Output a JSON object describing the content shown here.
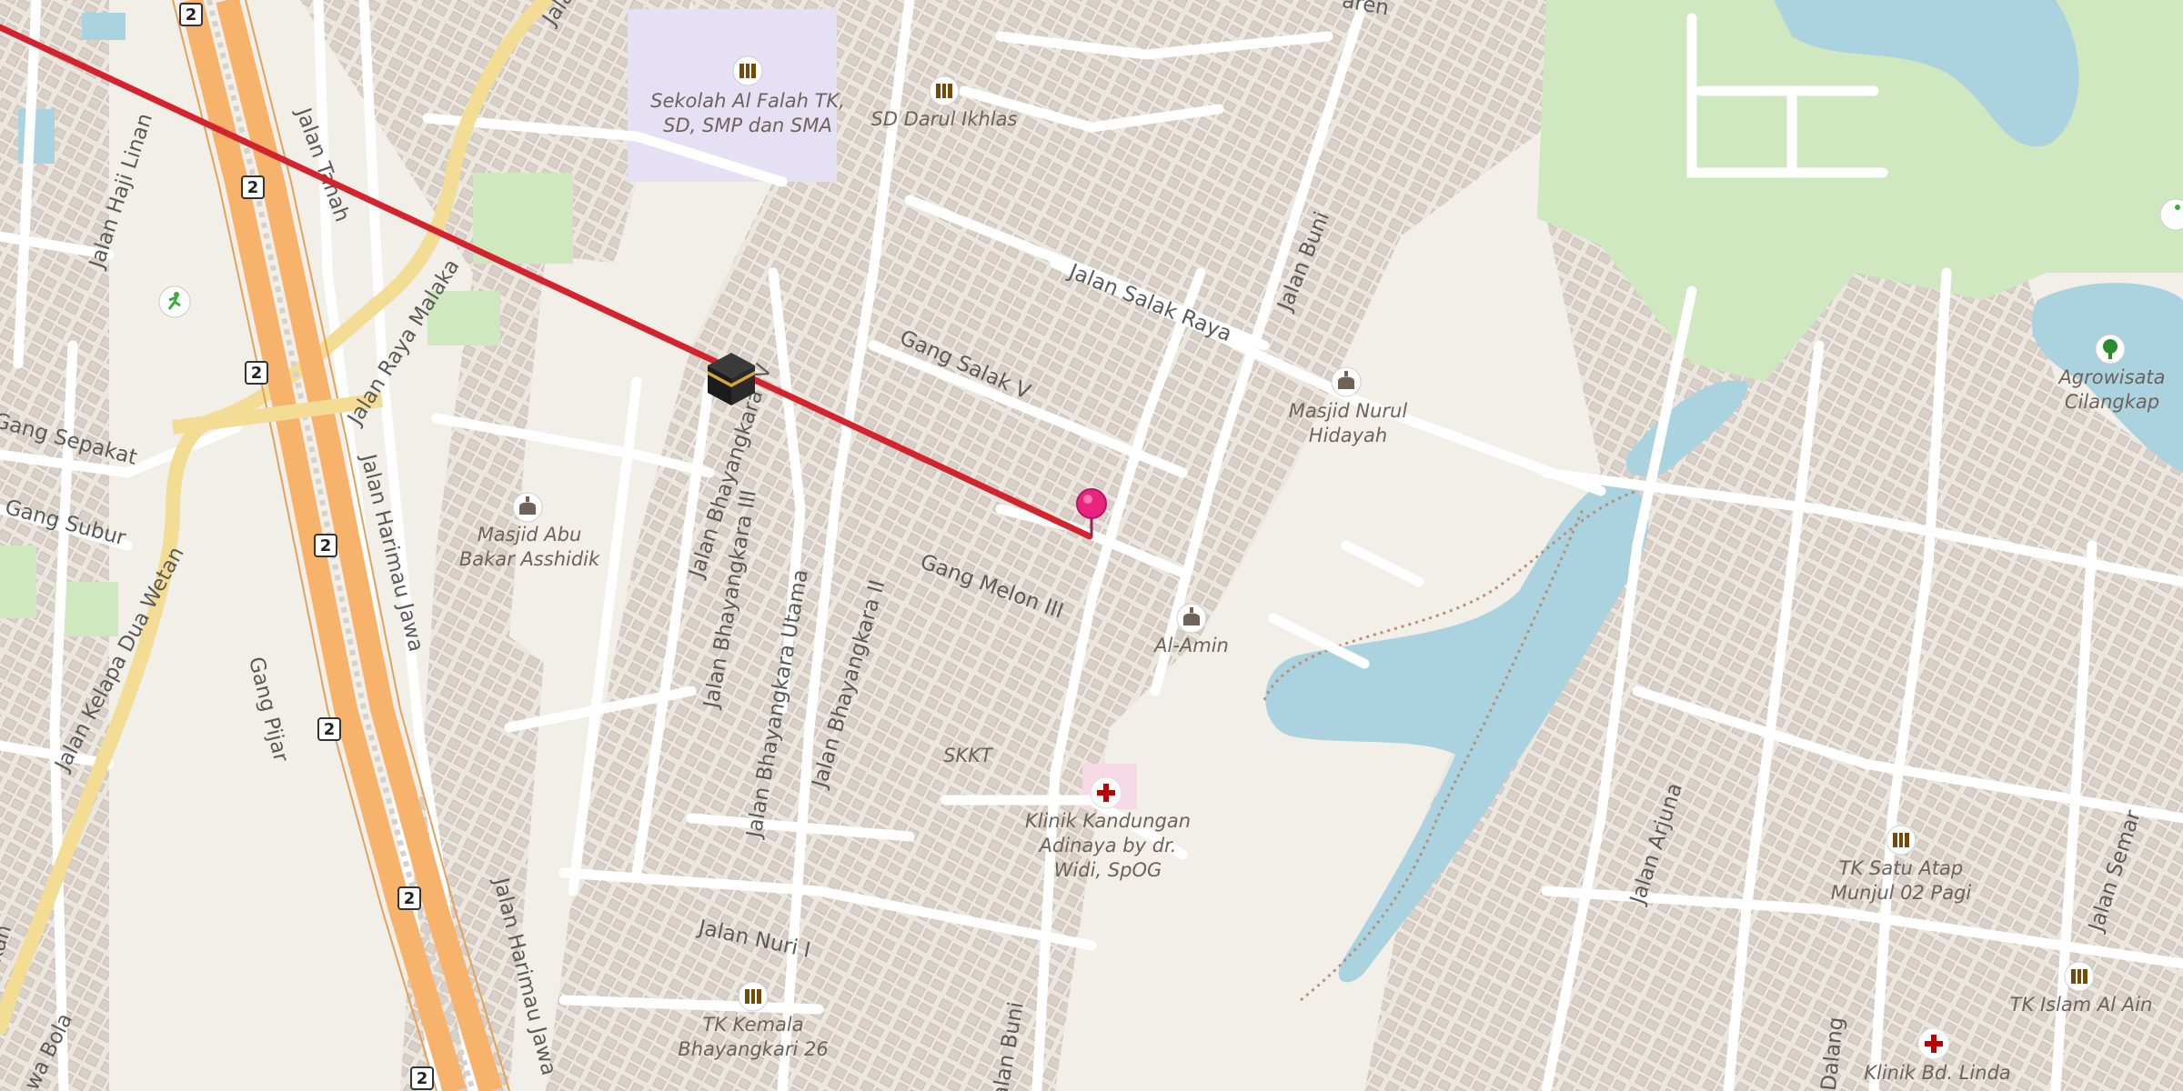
{
  "map": {
    "route_color": "#d5232d",
    "pin_color": "#e8247c",
    "water_color": "#aad3df",
    "park_color": "#c8e6b8",
    "pois": [
      {
        "id": "school-alfalah",
        "icon": "school-icon",
        "label_lines": [
          "Sekolah Al Falah TK,",
          "SD, SMP dan SMA"
        ]
      },
      {
        "id": "school-darul",
        "icon": "school-icon",
        "label_lines": [
          "SD Darul Ikhlas"
        ]
      },
      {
        "id": "mosque-nurul",
        "icon": "mosque-icon",
        "label_lines": [
          "Masjid Nurul",
          "Hidayah"
        ]
      },
      {
        "id": "mosque-abu",
        "icon": "mosque-icon",
        "label_lines": [
          "Masjid Abu",
          "Bakar Asshidik"
        ]
      },
      {
        "id": "mosque-alamin",
        "icon": "mosque-icon",
        "label_lines": [
          "Al-Amin"
        ]
      },
      {
        "id": "clinic-kandungan",
        "icon": "clinic-icon",
        "label_lines": [
          "Klinik Kandungan",
          "Adinaya by dr.",
          "Widi, SpOG"
        ]
      },
      {
        "id": "school-tk-satu",
        "icon": "school-icon",
        "label_lines": [
          "TK Satu Atap",
          "Munjul 02 Pagi"
        ]
      },
      {
        "id": "school-tk-islam",
        "icon": "school-icon",
        "label_lines": [
          "TK Islam Al Ain"
        ]
      },
      {
        "id": "school-tk-kemala",
        "icon": "school-icon",
        "label_lines": [
          "TK Kemala",
          "Bhayangkari 26"
        ]
      },
      {
        "id": "clinic-linda",
        "icon": "clinic-icon",
        "label_lines": [
          "Klinik Bd. Linda"
        ]
      },
      {
        "id": "park-agro",
        "icon": "park-icon",
        "label_lines": [
          "Agrowisata",
          "Cilangkap"
        ]
      },
      {
        "id": "sports",
        "icon": "sports-icon",
        "label_lines": []
      },
      {
        "id": "skkt",
        "icon": "",
        "label_lines": [
          "SKKT"
        ]
      }
    ],
    "streets": [
      {
        "id": "salak-raya",
        "name": "Jalan Salak Raya"
      },
      {
        "id": "gang-salak-v",
        "name": "Gang Salak V"
      },
      {
        "id": "jalan-buni",
        "name": "Jalan Buni"
      },
      {
        "id": "jalan-buni-2",
        "name": "Jalan Buni"
      },
      {
        "id": "gang-melon",
        "name": "Gang Melon III"
      },
      {
        "id": "bhayangkara-iv",
        "name": "Jalan Bhayangkara IV"
      },
      {
        "id": "bhayangkara-iii",
        "name": "Jalan Bhayangkara III"
      },
      {
        "id": "bhayangkara-utama",
        "name": "Jalan Bhayangkara Utama"
      },
      {
        "id": "bhayangkara-ii",
        "name": "Jalan Bhayangkara II"
      },
      {
        "id": "nuri-i",
        "name": "Jalan Nuri I"
      },
      {
        "id": "arjuna",
        "name": "Jalan Arjuna"
      },
      {
        "id": "semar",
        "name": "Jalan Semar"
      },
      {
        "id": "dalang",
        "name": "Dalang"
      },
      {
        "id": "raya-malaka",
        "name": "Jalan Raya Malaka"
      },
      {
        "id": "tanah",
        "name": "Jalan Tanah"
      },
      {
        "id": "haji-linan",
        "name": "Jalan Haji Linan"
      },
      {
        "id": "gang-sepakat",
        "name": "Gang Sepakat"
      },
      {
        "id": "gang-subur",
        "name": "Gang Subur"
      },
      {
        "id": "harimau-jawa",
        "name": "Jalan Harimau Jawa"
      },
      {
        "id": "harimau-jawa-2",
        "name": "Jalan Harimau Jawa"
      },
      {
        "id": "kelapa-dua",
        "name": "Jalan Kelapa Dua Wetan"
      },
      {
        "id": "gang-pijar",
        "name": "Gang Pijar"
      },
      {
        "id": "wa-bola",
        "name": "wa Bola"
      },
      {
        "id": "kan",
        "name": "kan"
      },
      {
        "id": "jala",
        "name": "Jala"
      },
      {
        "id": "aren",
        "name": "aren"
      }
    ],
    "highway_ref": "2",
    "markers": {
      "kaaba": "kaaba-icon",
      "pin": "map-pin-icon"
    }
  }
}
